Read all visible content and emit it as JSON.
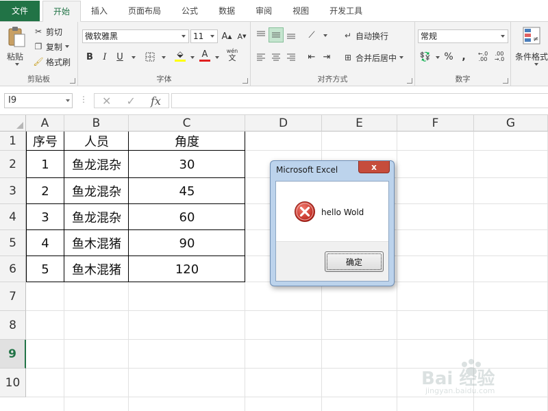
{
  "ribbon_tabs": [
    "文件",
    "开始",
    "插入",
    "页面布局",
    "公式",
    "数据",
    "审阅",
    "视图",
    "开发工具"
  ],
  "active_tab": "开始",
  "clipboard": {
    "paste": "粘贴",
    "cut": "剪切",
    "copy": "复制",
    "format_painter": "格式刷",
    "label": "剪贴板"
  },
  "font": {
    "name": "微软雅黑",
    "size": "11",
    "grow": "A",
    "shrink": "A",
    "bold": "B",
    "italic": "I",
    "underline": "U",
    "phonetic": "wén",
    "label": "字体"
  },
  "alignment": {
    "wrap_text": "自动换行",
    "merge_center": "合并后居中",
    "label": "对齐方式"
  },
  "number": {
    "format": "常规",
    "percent": "%",
    "comma": ",",
    "inc_decimal": ".00",
    "dec_decimal": ".00",
    "label": "数字"
  },
  "styles": {
    "conditional_format": "条件格式"
  },
  "formula_bar": {
    "name_box": "I9",
    "fx": "fx",
    "formula": ""
  },
  "grid": {
    "columns": [
      "A",
      "B",
      "C",
      "D",
      "E",
      "F",
      "G"
    ],
    "rows": [
      "1",
      "2",
      "3",
      "4",
      "5",
      "6",
      "7",
      "8",
      "9",
      "10"
    ],
    "active_row": "9",
    "header": [
      "序号",
      "人员",
      "角度"
    ],
    "data": [
      [
        "1",
        "鱼龙混杂",
        "30"
      ],
      [
        "2",
        "鱼龙混杂",
        "45"
      ],
      [
        "3",
        "鱼龙混杂",
        "60"
      ],
      [
        "4",
        "鱼木混猪",
        "90"
      ],
      [
        "5",
        "鱼木混猪",
        "120"
      ]
    ]
  },
  "dialog": {
    "title": "Microsoft Excel",
    "close": "x",
    "message": "hello Wold",
    "ok": "确定"
  },
  "watermark": {
    "brand": "Bai 经验",
    "url": "jingyan.baidu.com"
  },
  "colors": {
    "excel_green": "#217346",
    "error_red": "#d0342c",
    "dialog_frame": "#bcd3ec"
  }
}
